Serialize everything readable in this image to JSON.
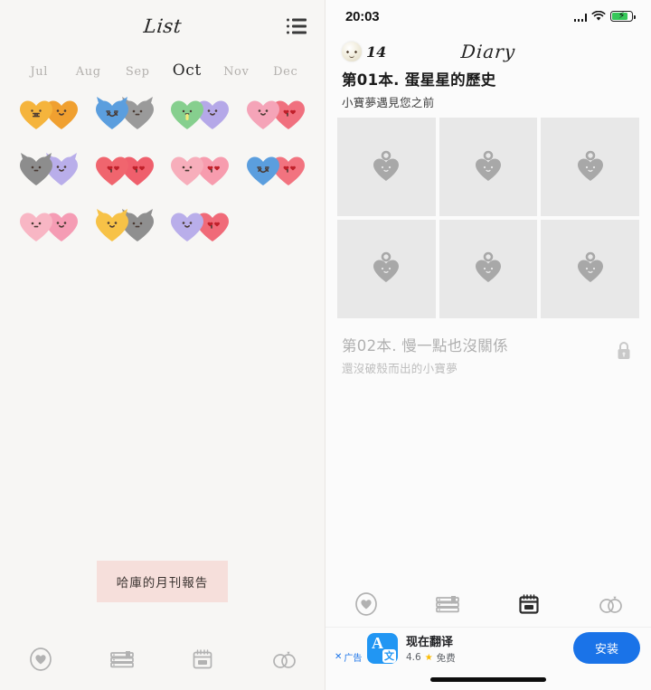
{
  "left": {
    "header": {
      "title": "List",
      "menu_icon": "list-icon"
    },
    "months": [
      {
        "label": "Jul",
        "active": false
      },
      {
        "label": "Aug",
        "active": false
      },
      {
        "label": "Sep",
        "active": false
      },
      {
        "label": "Oct",
        "active": true
      },
      {
        "label": "Nov",
        "active": false
      },
      {
        "label": "Dec",
        "active": false
      }
    ],
    "heart_rows": [
      [
        {
          "left_color": "#f5b43c",
          "right_color": "#f0a030",
          "left_face": "grin",
          "right_face": "smile",
          "ears": false
        },
        {
          "left_color": "#5b9ede",
          "right_color": "#9a9a9a",
          "left_face": "cry",
          "right_face": "flat",
          "ears": true
        },
        {
          "left_color": "#86cf8e",
          "right_color": "#b5a8e8",
          "left_face": "sick",
          "right_face": "smile",
          "ears": false
        },
        {
          "left_color": "#f5a4b8",
          "right_color": "#f0707e",
          "left_face": "smile",
          "right_face": "love",
          "ears": false
        }
      ],
      [
        {
          "left_color": "#8d8d8d",
          "right_color": "#b9aeea",
          "left_face": "flat",
          "right_face": "smile",
          "ears": true
        },
        {
          "left_color": "#f0656e",
          "right_color": "#ef5f6c",
          "left_face": "love",
          "right_face": "love",
          "ears": false
        },
        {
          "left_color": "#f7aebb",
          "right_color": "#f79cae",
          "left_face": "flat",
          "right_face": "love",
          "ears": false
        },
        {
          "left_color": "#5b9ede",
          "right_color": "#f2737f",
          "left_face": "cry",
          "right_face": "love",
          "ears": false
        }
      ],
      [
        {
          "left_color": "#f8b6c4",
          "right_color": "#f59cb4",
          "left_face": "flat",
          "right_face": "smile",
          "ears": false
        },
        {
          "left_color": "#f7c247",
          "right_color": "#8f8f8f",
          "left_face": "smile",
          "right_face": "flat",
          "ears": true
        },
        {
          "left_color": "#b9aeea",
          "right_color": "#f06a78",
          "left_face": "smile",
          "right_face": "love",
          "ears": false
        }
      ]
    ],
    "report_button": {
      "label": "哈庫的月刊報告",
      "bg": "#f6dfdb"
    },
    "nav": [
      {
        "icon": "heart-circle-icon",
        "label": "heart",
        "active": false
      },
      {
        "icon": "books-icon",
        "label": "books",
        "active": false
      },
      {
        "icon": "calendar-icon",
        "label": "calendar",
        "active": false
      },
      {
        "icon": "rings-icon",
        "label": "rings",
        "active": false
      }
    ]
  },
  "right": {
    "status": {
      "time": "20:03",
      "signal_icon": "cellular-signal-icon",
      "wifi_icon": "wifi-icon",
      "battery_icon": "battery-charging-icon",
      "battery_color": "#35c759"
    },
    "header": {
      "title": "Diary",
      "egg_icon": "egg-character-icon",
      "egg_count": "14"
    },
    "books": [
      {
        "title": "第01本. 蛋星星的歷史",
        "subtitle": "小寶夢遇見您之前",
        "locked": false
      },
      {
        "title": "第02本. 慢一點也沒關係",
        "subtitle": "還沒破殼而出的小寶夢",
        "locked": true,
        "lock_icon": "lock-icon"
      }
    ],
    "photo_tiles": [
      {
        "icon": "heart-tag-placeholder-icon"
      },
      {
        "icon": "heart-tag-placeholder-icon"
      },
      {
        "icon": "heart-tag-placeholder-icon"
      },
      {
        "icon": "heart-tag-placeholder-icon"
      },
      {
        "icon": "heart-tag-placeholder-icon"
      },
      {
        "icon": "heart-tag-placeholder-icon"
      }
    ],
    "nav": [
      {
        "icon": "heart-circle-icon",
        "label": "heart",
        "active": false
      },
      {
        "icon": "books-icon",
        "label": "books",
        "active": false
      },
      {
        "icon": "calendar-icon",
        "label": "calendar",
        "active": true
      },
      {
        "icon": "rings-icon",
        "label": "rings",
        "active": false
      }
    ],
    "ad": {
      "close_label": "广告",
      "close_icon": "close-icon",
      "app_icon": "translate-app-icon",
      "app_icon_letter": "A",
      "app_icon_letter_cn": "文",
      "app_name": "现在翻译",
      "rating": "4.6",
      "star_icon": "star-icon",
      "price": "免费",
      "install_label": "安装",
      "install_color": "#1a73e8"
    },
    "home_indicator": "home-indicator"
  }
}
